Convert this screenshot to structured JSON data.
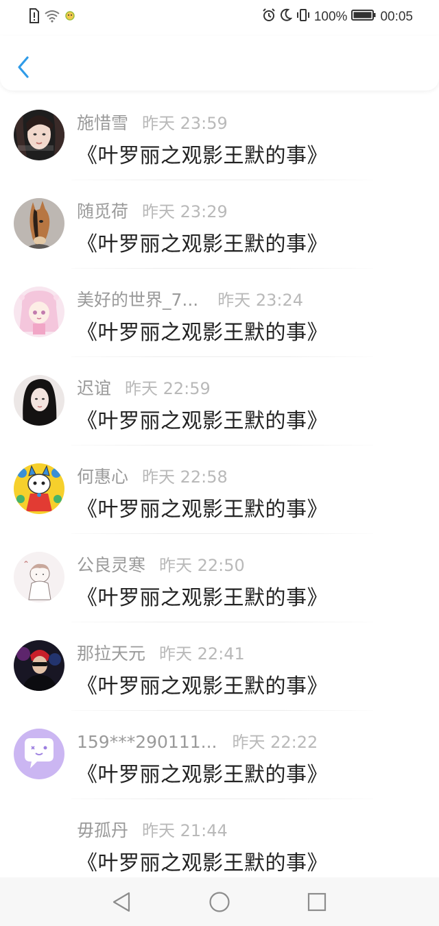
{
  "status_bar": {
    "battery_percent": "100%",
    "time": "00:05",
    "icons": [
      "sim-alert-icon",
      "wifi-icon",
      "emoji-notification-icon",
      "alarm-icon",
      "moon-icon",
      "vibrate-icon",
      "battery-icon"
    ]
  },
  "header": {
    "back_icon": "chevron-left-icon",
    "accent_color": "#2f9be8"
  },
  "items": [
    {
      "name": "施惜雪",
      "time": "昨天 23:59",
      "title": "《叶罗丽之观影王默的事》",
      "avatar_color": "#2b2b2b"
    },
    {
      "name": "随觅荷",
      "time": "昨天 23:29",
      "title": "《叶罗丽之观影王默的事》",
      "avatar_color": "#b9b3ad"
    },
    {
      "name": "美好的世界_7...",
      "time": "昨天 23:24",
      "title": "《叶罗丽之观影王默的事》",
      "avatar_color": "#f6dce9"
    },
    {
      "name": "迟谊",
      "time": "昨天 22:59",
      "title": "《叶罗丽之观影王默的事》",
      "avatar_color": "#e9e3e3"
    },
    {
      "name": "何惠心",
      "time": "昨天 22:58",
      "title": "《叶罗丽之观影王默的事》",
      "avatar_color": "#f5d02a"
    },
    {
      "name": "公良灵寒",
      "time": "昨天 22:50",
      "title": "《叶罗丽之观影王默的事》",
      "avatar_color": "#f4eeef"
    },
    {
      "name": "那拉天元",
      "time": "昨天 22:41",
      "title": "《叶罗丽之观影王默的事》",
      "avatar_color": "#1d1a24"
    },
    {
      "name": "159***290111...",
      "time": "昨天 22:22",
      "title": "《叶罗丽之观影王默的事》",
      "avatar_color": "#c9b4f0"
    },
    {
      "name": "毋孤丹",
      "time": "昨天 21:44",
      "title": "《叶罗丽之观影王默的事》",
      "avatar_color": ""
    }
  ],
  "nav": {
    "back": "triangle-back-icon",
    "home": "circle-home-icon",
    "recents": "square-recents-icon"
  }
}
